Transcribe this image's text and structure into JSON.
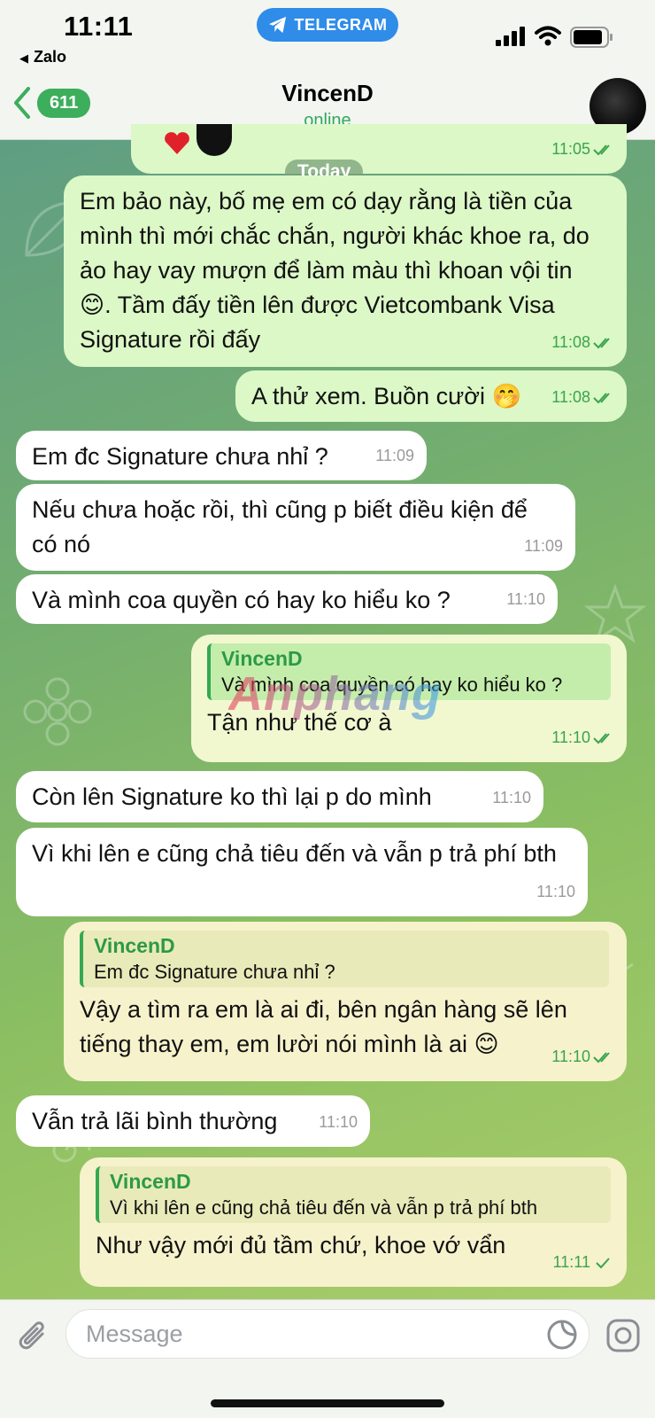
{
  "status_bar": {
    "time": "11:11",
    "back_app": "Zalo",
    "back_arrow": "◀",
    "app_pill": "TELEGRAM"
  },
  "header": {
    "unread_count": "611",
    "title": "VincenD",
    "status": "online"
  },
  "date_separator": "Today",
  "watermark": "Anphang",
  "messages": [
    {
      "dir": "out",
      "text": "Em bảo này, bố mẹ em có dạy rằng là tiền của mình thì mới chắc chắn, người khác khoe ra, do ảo hay vay mượn để làm màu thì khoan vội tin 😊. Tầm đấy tiền lên được Vietcombank Visa Signature rồi đấy",
      "time": "11:08",
      "status": "read"
    },
    {
      "dir": "out",
      "text": "A thử xem. Buồn cười 🤭",
      "time": "11:08",
      "status": "read"
    },
    {
      "dir": "in",
      "text": "Em đc Signature chưa nhỉ ?",
      "time": "11:09"
    },
    {
      "dir": "in",
      "text": "Nếu chưa hoặc rồi, thì cũng p biết điều kiện để có nó",
      "time": "11:09"
    },
    {
      "dir": "in",
      "text": "Và mình coa quyền có hay ko hiểu ko ?",
      "time": "11:10"
    },
    {
      "dir": "out",
      "reply_to": {
        "name": "VincenD",
        "text": "Và mình coa quyền có hay ko hiểu ko ?"
      },
      "text": "Tận như thế cơ à",
      "time": "11:10",
      "status": "read"
    },
    {
      "dir": "in",
      "text": "Còn lên Signature ko thì lại p do mình",
      "time": "11:10"
    },
    {
      "dir": "in",
      "text": "Vì khi lên e cũng chả tiêu đến và vẫn p trả phí bth",
      "time": "11:10"
    },
    {
      "dir": "out",
      "reply_to": {
        "name": "VincenD",
        "text": "Em đc Signature chưa nhỉ ?"
      },
      "text": "Vậy a tìm ra em là ai đi, bên ngân hàng sẽ lên tiếng thay em, em lười nói mình là ai 😊",
      "time": "11:10",
      "status": "read"
    },
    {
      "dir": "in",
      "text": "Vẫn trả lãi bình thường",
      "time": "11:10"
    },
    {
      "dir": "out",
      "reply_to": {
        "name": "VincenD",
        "text": "Vì khi lên e cũng chả tiêu đến và vẫn p trả phí bth"
      },
      "text": "Như vậy mới đủ tầm chứ, khoe vớ vẩn",
      "time": "11:11",
      "status": "sent"
    }
  ],
  "top_partial_time": "11:05",
  "input": {
    "placeholder": "Message"
  },
  "colors": {
    "accent": "#2eaa5b",
    "badge": "#3cae5c",
    "telegram_pill": "#2f8ce8",
    "outgoing_bubble": "#dbf8c6",
    "incoming_bubble": "#ffffff"
  },
  "icons": [
    "back-chevron-icon",
    "telegram-icon",
    "signal-icon",
    "wifi-icon",
    "battery-icon",
    "double-check-icon",
    "single-check-icon",
    "attach-icon",
    "sticker-icon",
    "camera-icon",
    "heart-icon"
  ]
}
